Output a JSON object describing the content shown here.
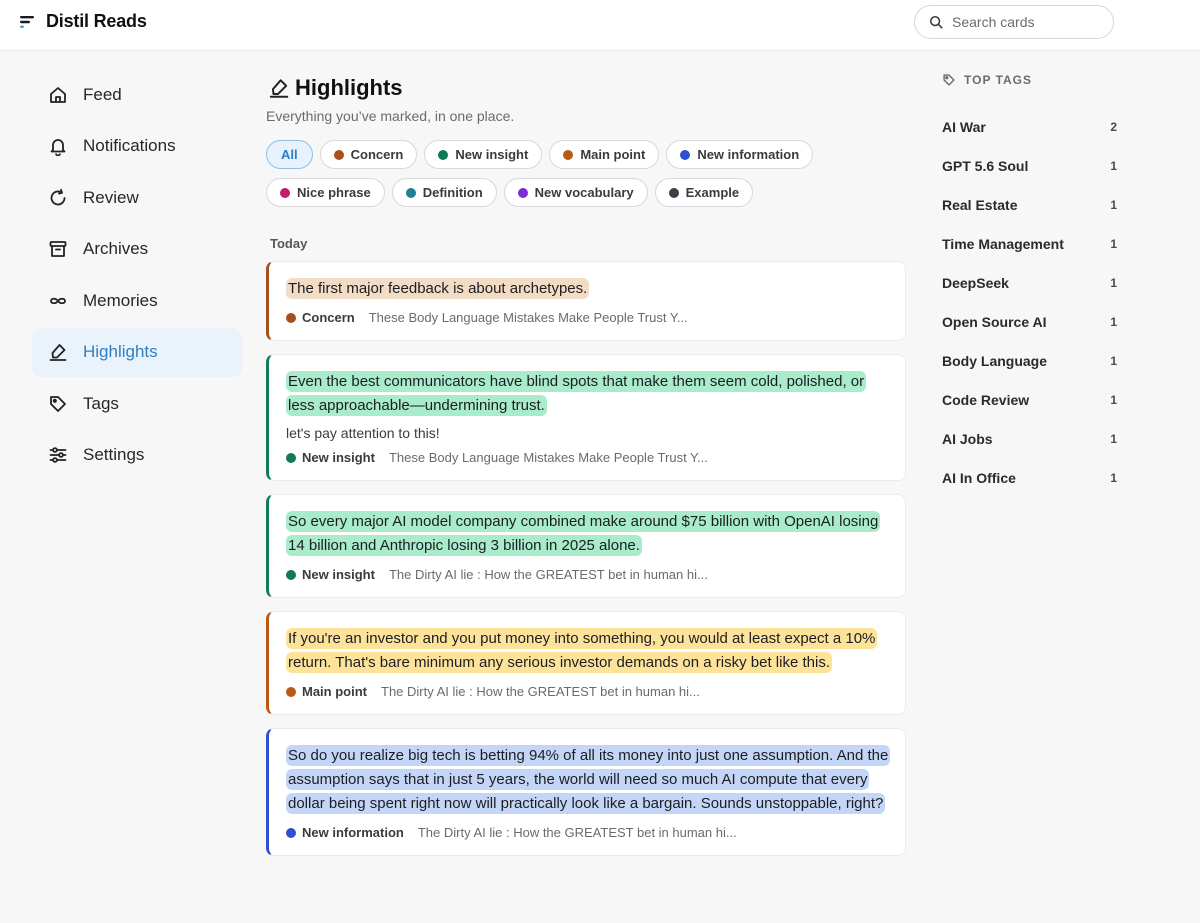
{
  "app": {
    "title": "Distil Reads"
  },
  "search": {
    "placeholder": "Search cards"
  },
  "sidebar": {
    "items": [
      {
        "label": "Feed",
        "icon": "home-icon"
      },
      {
        "label": "Notifications",
        "icon": "bell-icon"
      },
      {
        "label": "Review",
        "icon": "refresh-icon"
      },
      {
        "label": "Archives",
        "icon": "archive-icon"
      },
      {
        "label": "Memories",
        "icon": "infinity-icon"
      },
      {
        "label": "Highlights",
        "icon": "highlighter-icon",
        "active": true
      },
      {
        "label": "Tags",
        "icon": "tag-icon"
      },
      {
        "label": "Settings",
        "icon": "sliders-icon"
      }
    ]
  },
  "main": {
    "title": "Highlights",
    "subtitle": "Everything you’ve marked, in one place.",
    "filters": [
      {
        "label": "All",
        "active": true
      },
      {
        "label": "Concern",
        "color": "#a4521b"
      },
      {
        "label": "New insight",
        "color": "#137a56"
      },
      {
        "label": "Main point",
        "color": "#b85a14"
      },
      {
        "label": "New information",
        "color": "#2f4fd1"
      },
      {
        "label": "Nice phrase",
        "color": "#c21c6b"
      },
      {
        "label": "Definition",
        "color": "#1f7f95"
      },
      {
        "label": "New vocabulary",
        "color": "#7b2fd0"
      },
      {
        "label": "Example",
        "color": "#3b3f4a"
      }
    ],
    "section_label": "Today",
    "cards": [
      {
        "text": "The first major feedback is about archetypes.",
        "tag": "Concern",
        "tag_color": "#a4521b",
        "highlight_bg": "#f3dcc6",
        "source": "These Body Language Mistakes Make People Trust Y..."
      },
      {
        "text": "Even the best communicators have blind spots that make them seem cold, polished, or less approachable—undermining trust.",
        "note": "let's pay attention to this!",
        "tag": "New insight",
        "tag_color": "#137a56",
        "highlight_bg": "#a8eccb",
        "source": "These Body Language Mistakes Make People Trust Y..."
      },
      {
        "text": "So every major AI model company combined make around $75 billion with OpenAI losing 14 billion and Anthropic losing 3 billion in 2025 alone.",
        "tag": "New insight",
        "tag_color": "#137a56",
        "highlight_bg": "#a8eccb",
        "source": "The Dirty AI lie : How the GREATEST bet in human hi..."
      },
      {
        "text": "If you're an investor and you put money into something, you would at least expect a 10% return. That's bare minimum any serious investor demands on a risky bet like this.",
        "tag": "Main point",
        "tag_color": "#b85a14",
        "highlight_bg": "#fde39a",
        "source": "The Dirty AI lie : How the GREATEST bet in human hi..."
      },
      {
        "text": "So do you realize big tech is betting 94% of all its money into just one assumption. And the assumption says that in just 5 years, the world will need so much AI compute that every dollar being spent right now will practically look like a bargain. Sounds unstoppable, right?",
        "tag": "New information",
        "tag_color": "#2f4fd1",
        "highlight_bg": "#c4d6f7",
        "source": "The Dirty AI lie : How the GREATEST bet in human hi..."
      }
    ]
  },
  "top_tags": {
    "title": "TOP TAGS",
    "items": [
      {
        "name": "AI War",
        "count": "2"
      },
      {
        "name": "GPT 5.6 Soul",
        "count": "1"
      },
      {
        "name": "Real Estate",
        "count": "1"
      },
      {
        "name": "Time Management",
        "count": "1"
      },
      {
        "name": "DeepSeek",
        "count": "1"
      },
      {
        "name": "Open Source AI",
        "count": "1"
      },
      {
        "name": "Body Language",
        "count": "1"
      },
      {
        "name": "Code Review",
        "count": "1"
      },
      {
        "name": "AI Jobs",
        "count": "1"
      },
      {
        "name": "AI In Office",
        "count": "1"
      }
    ]
  }
}
